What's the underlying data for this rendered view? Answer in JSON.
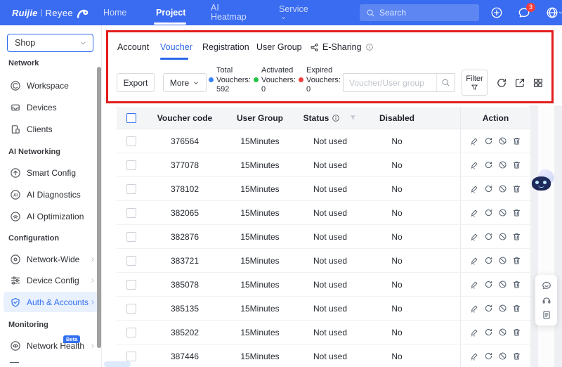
{
  "navbar": {
    "brand": "Ruijie",
    "brand_sep": "|",
    "brand_product": "Reyee",
    "items": {
      "home": "Home",
      "project": "Project",
      "ai_heatmap_line1": "AI",
      "ai_heatmap_line2": "Heatmap",
      "service": "Service"
    },
    "search_placeholder": "Search",
    "notification_count": "3"
  },
  "sidebar": {
    "org_selector": "Shop",
    "sections": [
      {
        "title": "Network",
        "items": [
          {
            "label": "Workspace",
            "icon": "workspace"
          },
          {
            "label": "Devices",
            "icon": "devices"
          },
          {
            "label": "Clients",
            "icon": "clients"
          }
        ]
      },
      {
        "title": "AI Networking",
        "items": [
          {
            "label": "Smart Config",
            "icon": "smart-config"
          },
          {
            "label": "AI Diagnostics",
            "icon": "ai-diagnostics"
          },
          {
            "label": "AI Optimization",
            "icon": "ai-optimization"
          }
        ]
      },
      {
        "title": "Configuration",
        "items": [
          {
            "label": "Network-Wide",
            "icon": "network-wide",
            "chevron": true
          },
          {
            "label": "Device Config",
            "icon": "device-config",
            "chevron": true
          },
          {
            "label": "Auth & Accounts",
            "icon": "auth-accounts",
            "chevron": true,
            "active": true
          }
        ]
      },
      {
        "title": "Monitoring",
        "items": [
          {
            "label": "Network Health",
            "icon": "network-health",
            "chevron": true,
            "badge": "Beta"
          }
        ]
      }
    ]
  },
  "tabs": {
    "items": [
      {
        "label": "Account"
      },
      {
        "label": "Voucher",
        "active": true
      },
      {
        "label": "Registration"
      },
      {
        "label": "User Group"
      },
      {
        "label": "E-Sharing",
        "has_share_icon": true,
        "has_info_icon": true
      }
    ]
  },
  "toolbar": {
    "export_label": "Export",
    "more_label": "More",
    "stats": [
      {
        "line1": "Total",
        "line2": "Vouchers:",
        "value": "592",
        "color": "#3b82f6"
      },
      {
        "line1": "Activated",
        "line2": "Vouchers:",
        "value": "0",
        "color": "#23c343"
      },
      {
        "line1": "Expired",
        "line2": "Vouchers:",
        "value": "0",
        "color": "#f53f3f"
      }
    ],
    "search_placeholder": "Voucher/User group",
    "filter_label": "Filter"
  },
  "table": {
    "headers": {
      "voucher_code": "Voucher code",
      "user_group": "User Group",
      "status": "Status",
      "disabled": "Disabled",
      "action": "Action"
    },
    "rows": [
      {
        "code": "376564",
        "group": "15Minutes",
        "status": "Not used",
        "disabled": "No"
      },
      {
        "code": "377078",
        "group": "15Minutes",
        "status": "Not used",
        "disabled": "No"
      },
      {
        "code": "378102",
        "group": "15Minutes",
        "status": "Not used",
        "disabled": "No"
      },
      {
        "code": "382065",
        "group": "15Minutes",
        "status": "Not used",
        "disabled": "No"
      },
      {
        "code": "382876",
        "group": "15Minutes",
        "status": "Not used",
        "disabled": "No"
      },
      {
        "code": "383721",
        "group": "15Minutes",
        "status": "Not used",
        "disabled": "No"
      },
      {
        "code": "385078",
        "group": "15Minutes",
        "status": "Not used",
        "disabled": "No"
      },
      {
        "code": "385135",
        "group": "15Minutes",
        "status": "Not used",
        "disabled": "No"
      },
      {
        "code": "385202",
        "group": "15Minutes",
        "status": "Not used",
        "disabled": "No"
      },
      {
        "code": "387446",
        "group": "15Minutes",
        "status": "Not used",
        "disabled": "No"
      }
    ]
  }
}
